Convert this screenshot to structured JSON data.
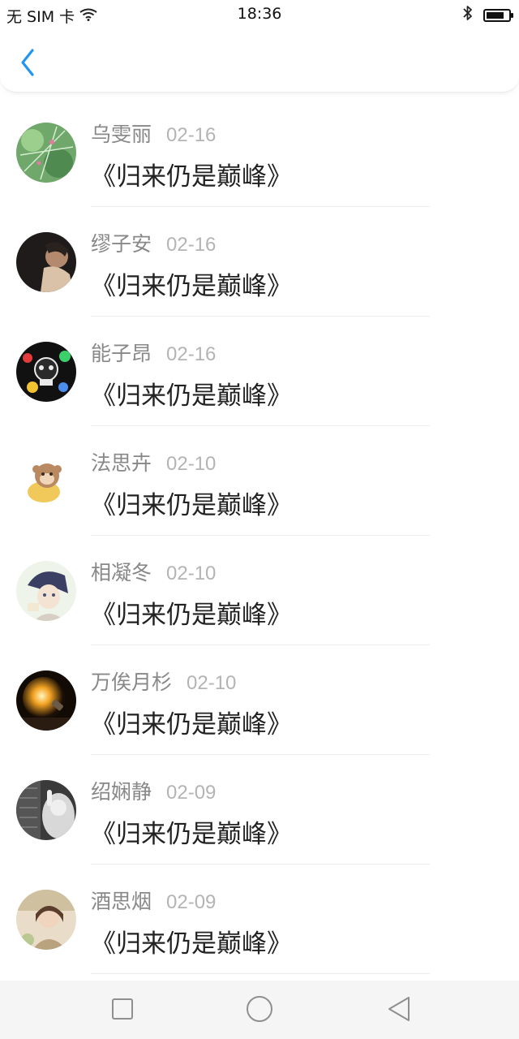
{
  "status_bar": {
    "carrier": "无 SIM 卡",
    "time": "18:36",
    "icons": [
      "wifi-icon",
      "bluetooth-icon",
      "battery-icon"
    ],
    "battery_level": 0.8
  },
  "header": {
    "back_icon": "chevron-left-icon",
    "accent_color": "#2196F3"
  },
  "list": {
    "items": [
      {
        "name": "乌雯丽",
        "date": "02-16",
        "title": "《归来仍是巅峰》"
      },
      {
        "name": "缪子安",
        "date": "02-16",
        "title": "《归来仍是巅峰》"
      },
      {
        "name": "能子昂",
        "date": "02-16",
        "title": "《归来仍是巅峰》"
      },
      {
        "name": "法思卉",
        "date": "02-10",
        "title": "《归来仍是巅峰》"
      },
      {
        "name": "相凝冬",
        "date": "02-10",
        "title": "《归来仍是巅峰》"
      },
      {
        "name": "万俟月杉",
        "date": "02-10",
        "title": "《归来仍是巅峰》"
      },
      {
        "name": "绍娴静",
        "date": "02-09",
        "title": "《归来仍是巅峰》"
      },
      {
        "name": "酒思烟",
        "date": "02-09",
        "title": "《归来仍是巅峰》"
      }
    ]
  },
  "nav_bar": {
    "icons": [
      "recents-square-icon",
      "home-circle-icon",
      "back-triangle-icon"
    ]
  }
}
